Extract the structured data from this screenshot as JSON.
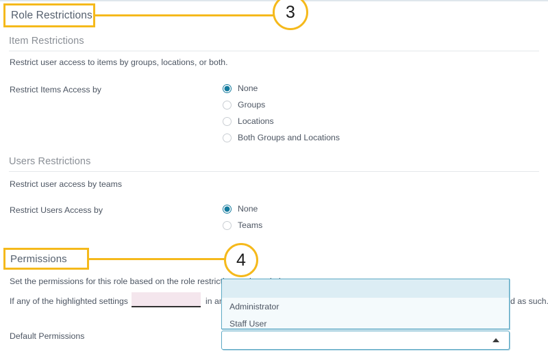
{
  "page": {
    "title": "Role Restrictions"
  },
  "annotations": [
    {
      "number": "3",
      "target": "Role Restrictions"
    },
    {
      "number": "4",
      "target": "Permissions"
    }
  ],
  "sections": {
    "role_restrictions": {
      "heading": "Role Restrictions"
    },
    "item_restrictions": {
      "heading": "Item Restrictions",
      "description": "Restrict user access to items by groups, locations, or both.",
      "field_label": "Restrict Items Access by",
      "options": [
        {
          "label": "None",
          "selected": true
        },
        {
          "label": "Groups",
          "selected": false
        },
        {
          "label": "Locations",
          "selected": false
        },
        {
          "label": "Both Groups and Locations",
          "selected": false
        }
      ]
    },
    "users_restrictions": {
      "heading": "Users Restrictions",
      "description": "Restrict user access by teams",
      "field_label": "Restrict Users Access by",
      "options": [
        {
          "label": "None",
          "selected": true
        },
        {
          "label": "Teams",
          "selected": false
        }
      ]
    },
    "permissions": {
      "heading": "Permissions",
      "description": "Set the permissions for this role based on the role restrictions selected above.",
      "inline_sentence_start": "If any of the highlighted settings",
      "inline_input_value": "",
      "inline_input_placeholder": "",
      "inline_sentence_middle": "in an",
      "inline_sentence_end": "d as such.",
      "default_permissions_label": "Default Permissions",
      "select_value": "",
      "dropdown_open": true,
      "dropdown_options": [
        {
          "label": "",
          "highlighted": true
        },
        {
          "label": "Administrator",
          "highlighted": false
        },
        {
          "label": "Staff User",
          "highlighted": false
        }
      ]
    }
  },
  "colors": {
    "accent_annotation": "#f5b91b",
    "radio_selected": "#147b9e",
    "select_border": "#5ba8c4",
    "dropdown_highlight": "#dcedf4",
    "pink_field": "#f4e6ed",
    "heading_gray": "#8a8f96",
    "body_gray": "#4c5562"
  }
}
